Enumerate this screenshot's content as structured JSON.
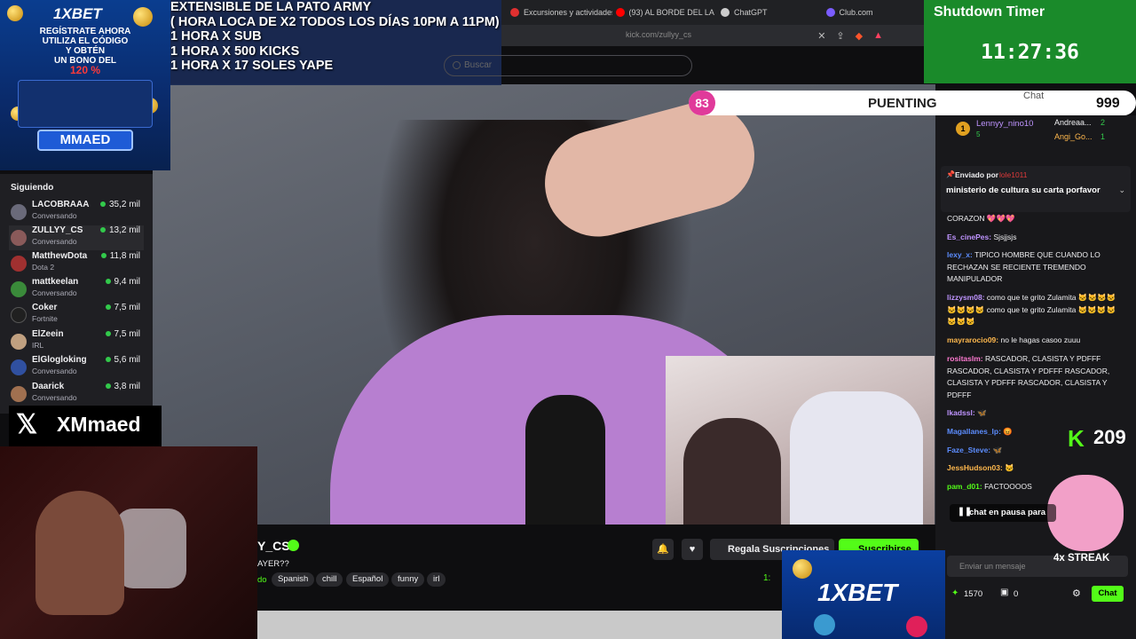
{
  "browser": {
    "tabs": [
      {
        "label": "Excursiones y actividades",
        "color": "#e03030"
      },
      {
        "label": "(93) AL BORDE DEL LA",
        "color": "#ff0000"
      },
      {
        "label": "ChatGPT",
        "color": "#cccccc"
      },
      {
        "label": "Club.com",
        "color": "#7a5cff"
      }
    ],
    "url": "kick.com/zullyy_cs"
  },
  "overlay_lines": [
    "EXTENSIBLE  DE LA PATO ARMY",
    "( HORA LOCA DE X2 TODOS LOS DÍAS 10PM A 11PM)",
    "1 HORA X SUB",
    "1 HORA X 500 KICKS",
    "1 HORA X 17 SOLES YAPE"
  ],
  "search": {
    "placeholder": "Buscar"
  },
  "ad_top": {
    "brand": "1XBET",
    "promo_lines": [
      "REGÍSTRATE AHORA",
      "UTILIZA EL CÓDIGO",
      "Y OBTÉN",
      "UN BONO DEL"
    ],
    "promo_pct": "120 %",
    "code": "MMAED"
  },
  "timer": {
    "title": "Shutdown Timer",
    "value": "11:27:36"
  },
  "sidebar": {
    "title": "Siguiendo",
    "channels": [
      {
        "name": "LACOBRAAA",
        "category": "Conversando",
        "viewers": "35,2 mil",
        "avatar": "#6a6a7a"
      },
      {
        "name": "ZULLYY_CS",
        "category": "Conversando",
        "viewers": "13,2 mil",
        "avatar": "#8a5a5a"
      },
      {
        "name": "MatthewDota",
        "category": "Dota 2",
        "viewers": "11,8 mil",
        "avatar": "#a03030"
      },
      {
        "name": "mattkeelan",
        "category": "Conversando",
        "viewers": "9,4 mil",
        "avatar": "#3a8a3a"
      },
      {
        "name": "Coker",
        "category": "Fortnite",
        "viewers": "7,5 mil",
        "avatar": "#202020"
      },
      {
        "name": "ElZeein",
        "category": "IRL",
        "viewers": "7,5 mil",
        "avatar": "#c0a080"
      },
      {
        "name": "ElGlogloking",
        "category": "Conversando",
        "viewers": "5,6 mil",
        "avatar": "#3050a0"
      },
      {
        "name": "Daarick",
        "category": "Conversando",
        "viewers": "3,8 mil",
        "avatar": "#a07050"
      }
    ]
  },
  "xm_label": "XMmaed",
  "event_bar": {
    "count_left": "83",
    "label": "PUENTING",
    "count_right": "999",
    "chat_title": "Chat"
  },
  "chat": {
    "leaders": [
      {
        "rank": "1",
        "name": "Lennyy_nino10",
        "sub": "5"
      },
      {
        "name": "Andreaa...",
        "count": "2"
      },
      {
        "name": "Angi_Go...",
        "count": "1"
      }
    ],
    "pinned": {
      "by_label": "Enviado por",
      "by_user": "lole1011",
      "text": "ministerio de cultura su carta porfavor"
    },
    "messages": [
      {
        "user": "",
        "text": "CORAZON 💖💖💖",
        "color": "#efeff1"
      },
      {
        "user": "Es_cinePes:",
        "text": "Sjsjjsjs",
        "color": "#bf94ff"
      },
      {
        "user": "lexy_x:",
        "text": "TIPICO HOMBRE QUE CUANDO LO RECHAZAN SE RECIENTE TREMENDO MANIPULADOR",
        "color": "#5c8dff"
      },
      {
        "user": "lizzysm08:",
        "text": "como que te grito Zulamita 🐱🐱🐱🐱🐱🐱🐱🐱 como que te grito Zulamita 🐱🐱🐱🐱🐱🐱🐱",
        "color": "#bf94ff"
      },
      {
        "user": "mayrarocio09:",
        "text": "no le hagas casoo zuuu",
        "color": "#ffb84d"
      },
      {
        "user": "rositaslm:",
        "text": "RASCADOR, CLASISTA Y PDFFF RASCADOR, CLASISTA Y PDFFF RASCADOR, CLASISTA Y PDFFF RASCADOR, CLASISTA Y PDFFF",
        "color": "#ff7ad1"
      },
      {
        "user": "lkadssl:",
        "text": "🦋",
        "color": "#bf94ff"
      },
      {
        "user": "Magallanes_lp:",
        "text": "😡",
        "color": "#5c8dff"
      },
      {
        "user": "Faze_Steve:",
        "text": "🦋",
        "color": "#5c8dff"
      },
      {
        "user": "JessHudson03:",
        "text": "🐱",
        "color": "#ffb84d"
      },
      {
        "user": "pam_d01:",
        "text": "FACTOOOOS",
        "color": "#53fc18"
      }
    ],
    "kick_count": "209",
    "paused": "chat en pausa para",
    "input_placeholder": "Enviar un mensaje",
    "streak": "4x STREAK",
    "points": "1570",
    "bits": "0",
    "send_label": "Chat"
  },
  "stream": {
    "channel": "Y_CS",
    "title": "AYER??",
    "category_link": "do",
    "tags": [
      "Spanish",
      "chill",
      "Español",
      "funny",
      "irl"
    ],
    "gift_label": "Regala Suscripciones",
    "sub_label": "Suscribirse",
    "viewers": "1:"
  },
  "ad_bottom": {
    "brand": "1XBET"
  }
}
